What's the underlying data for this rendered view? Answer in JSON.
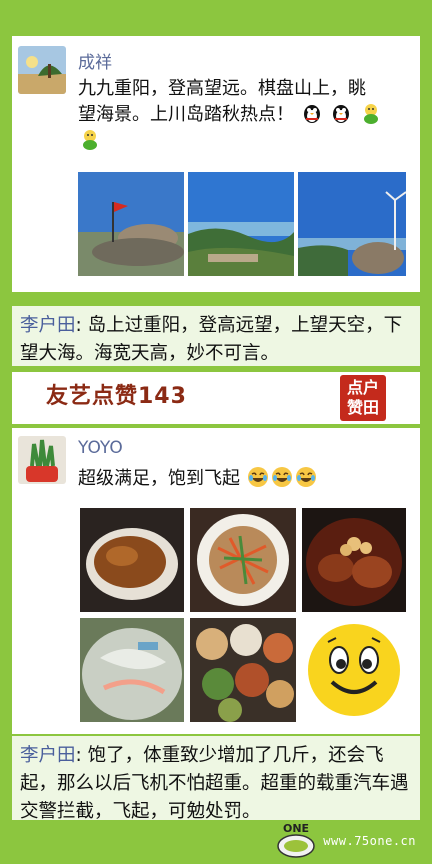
{
  "post1": {
    "username": "成祥",
    "text_line1": "九九重阳，登高望远。棋盘山上，眺",
    "text_line2": "望海景。上川岛踏秋热点！",
    "emoji_after": [
      "qq-penguin-icon",
      "qq-penguin-icon",
      "smiley-green-icon",
      "smiley-green-icon"
    ]
  },
  "comment1": {
    "name": "李户田",
    "text": ": 岛上过重阳，登高远望，上望天空，下望大海。海宽天高，妙不可言。"
  },
  "banner": {
    "text": "友艺点赞143",
    "seal_line1": "点户",
    "seal_line2": "赞田"
  },
  "post2": {
    "username": "YOYO",
    "text": "超级满足，饱到飞起"
  },
  "comment2": {
    "name": "李户田",
    "text": ": 饱了，体重致少增加了几斤，还会飞起，那么以后飞机不怕超重。超重的载重汽车遇交警拦截，飞起，可勉处罚。"
  },
  "watermark": {
    "logo": "ONE",
    "url": "www.75one.cn"
  },
  "colors": {
    "background": "#8cc63f",
    "name_blue": "#5b6b9a",
    "comment_bg": "#eef7e3",
    "banner_red": "#8b2a14"
  }
}
